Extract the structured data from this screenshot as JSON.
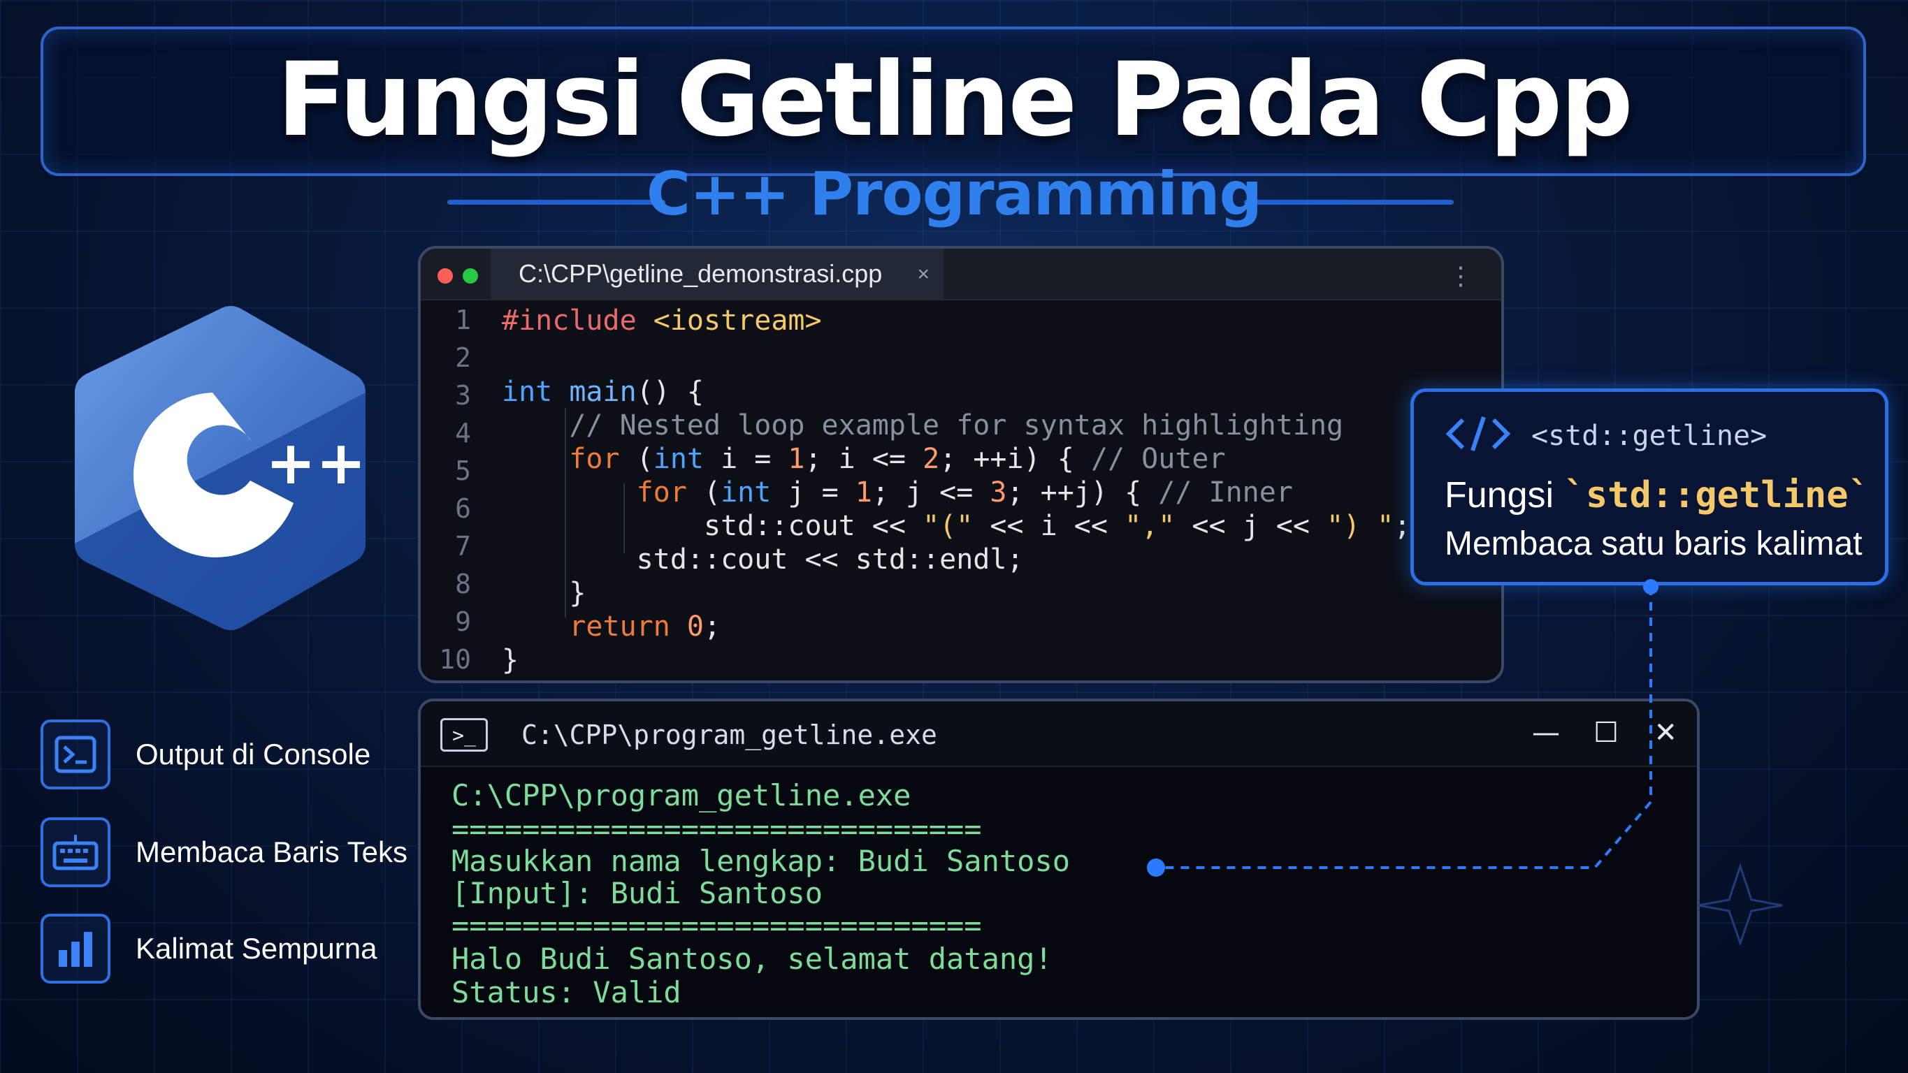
{
  "header": {
    "title": "Fungsi Getline Pada Cpp",
    "subtitle": "C++ Programming"
  },
  "logo": {
    "icon": "cpp-logo-icon",
    "plus_text": "++",
    "colors": {
      "light": "#5b8fe0",
      "dark": "#1e4fa6",
      "letter": "#ffffff"
    }
  },
  "features": [
    {
      "icon": "terminal-icon",
      "label": "Output di Console"
    },
    {
      "icon": "keyboard-icon",
      "label": "Membaca Baris Teks"
    },
    {
      "icon": "bar-chart-icon",
      "label": "Kalimat Sempurna"
    }
  ],
  "editor": {
    "tab_title": "C:\\CPP\\getline_demonstrasi.cpp",
    "close_glyph": "×",
    "menu_glyph": "⋮",
    "line_numbers": [
      "1",
      "2",
      "3",
      "4",
      "5",
      "6",
      "7",
      "8",
      "9",
      "10"
    ],
    "lines": [
      "#include <iostream>",
      "",
      "int main() {",
      "    // Nested loop example for syntax highlighting",
      "    for (int i = 1; i <= 2; ++i) { // Outer",
      "        for (int j = 1; j <= 3; ++j) { // Inner",
      "            std::cout << \"(\" << i << \",\" << j << \") \";",
      "        std::cout << std::endl;",
      "    }",
      "    return 0;",
      "}"
    ],
    "dot_colors": [
      "#ff5f57",
      "#28c840"
    ]
  },
  "card": {
    "icon": "code-brackets-icon",
    "tag": "<std::getline>",
    "line1_prefix": "Fungsi ",
    "line1_code": "`std::getline`",
    "line2": "Membaca satu baris kalimat"
  },
  "console": {
    "title": "C:\\CPP\\program_getline.exe",
    "icon_glyph": ">_",
    "minimize_glyph": "—",
    "maximize_glyph": "☐",
    "close_glyph": "✕",
    "output": [
      "C:\\CPP\\program_getline.exe",
      "==============================",
      "Masukkan nama lengkap: Budi Santoso",
      "[Input]: Budi Santoso",
      "==============================",
      "Halo Budi Santoso, selamat datang!",
      "Status: Valid"
    ]
  },
  "colors": {
    "accent": "#2f80ed",
    "console_text": "#7ddc9c",
    "connector": "#2b7bff"
  }
}
